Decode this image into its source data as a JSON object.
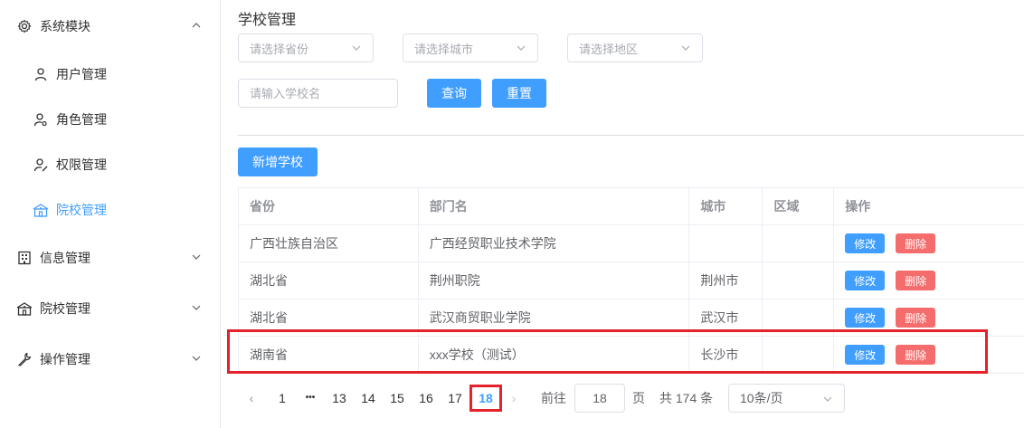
{
  "sidebar": {
    "system": "系统模块",
    "user_mgmt": "用户管理",
    "role_mgmt": "角色管理",
    "perm_mgmt": "权限管理",
    "school_mgmt_sub": "院校管理",
    "info_mgmt": "信息管理",
    "school_mgmt": "院校管理",
    "op_mgmt": "操作管理"
  },
  "page": {
    "title": "学校管理",
    "province_placeholder": "请选择省份",
    "city_placeholder": "请选择城市",
    "district_placeholder": "请选择地区",
    "school_placeholder": "请输入学校名",
    "query_label": "查询",
    "reset_label": "重置",
    "add_label": "新增学校"
  },
  "table": {
    "headers": [
      "省份",
      "部门名",
      "城市",
      "区域",
      "操作"
    ],
    "rows": [
      {
        "province": "广西壮族自治区",
        "dept": "广西经贸职业技术学院",
        "city": "",
        "district": ""
      },
      {
        "province": "湖北省",
        "dept": "荆州职院",
        "city": "荆州市",
        "district": ""
      },
      {
        "province": "湖北省",
        "dept": "武汉商贸职业学院",
        "city": "武汉市",
        "district": ""
      },
      {
        "province": "湖南省",
        "dept": "xxx学校（测试）",
        "city": "长沙市",
        "district": ""
      }
    ],
    "edit_label": "修改",
    "delete_label": "删除"
  },
  "pagination": {
    "prev": "‹",
    "first": "1",
    "ellipsis": "•••",
    "pages": [
      "13",
      "14",
      "15",
      "16",
      "17"
    ],
    "current": "18",
    "next": "›",
    "goto_label": "前往",
    "goto_value": "18",
    "page_unit": "页",
    "total": "共 174 条",
    "page_size": "10条/页"
  },
  "colors": {
    "primary": "#409eff",
    "danger": "#f56c6c",
    "highlight": "#e5212b"
  }
}
